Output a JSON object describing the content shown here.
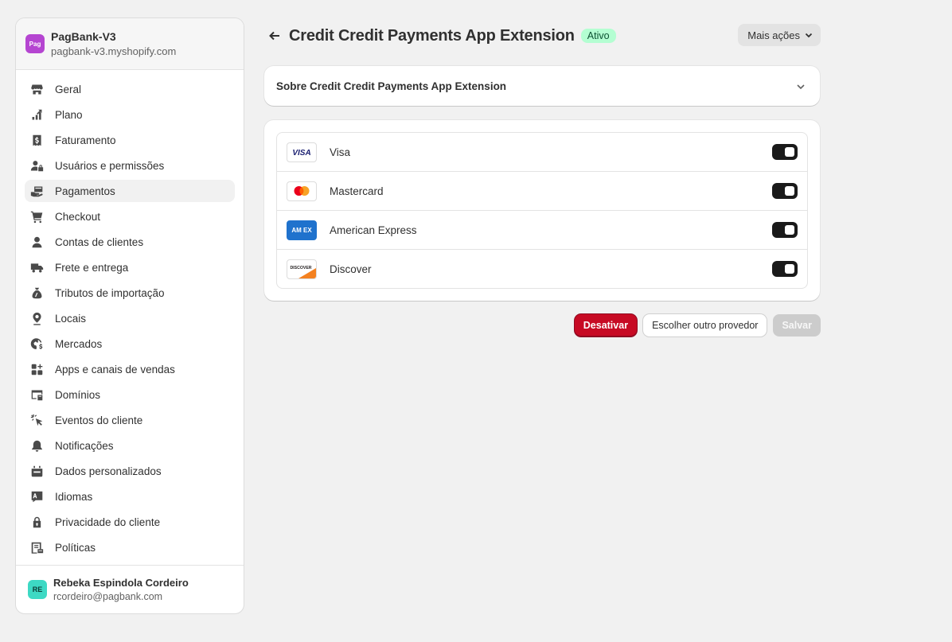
{
  "store": {
    "logo_text": "Pag",
    "name": "PagBank-V3",
    "domain": "pagbank-v3.myshopify.com"
  },
  "nav": {
    "items": [
      {
        "label": "Geral",
        "icon": "store-icon"
      },
      {
        "label": "Plano",
        "icon": "plan-chart-icon"
      },
      {
        "label": "Faturamento",
        "icon": "receipt-dollar-icon"
      },
      {
        "label": "Usuários e permissões",
        "icon": "users-lock-icon"
      },
      {
        "label": "Pagamentos",
        "icon": "payment-hand-icon",
        "active": true
      },
      {
        "label": "Checkout",
        "icon": "cart-icon"
      },
      {
        "label": "Contas de clientes",
        "icon": "person-icon"
      },
      {
        "label": "Frete e entrega",
        "icon": "truck-icon"
      },
      {
        "label": "Tributos de importação",
        "icon": "money-bag-icon"
      },
      {
        "label": "Locais",
        "icon": "location-pin-icon"
      },
      {
        "label": "Mercados",
        "icon": "globe-dollar-icon"
      },
      {
        "label": "Apps e canais de vendas",
        "icon": "apps-grid-icon"
      },
      {
        "label": "Domínios",
        "icon": "domain-window-icon"
      },
      {
        "label": "Eventos do cliente",
        "icon": "cursor-click-icon"
      },
      {
        "label": "Notificações",
        "icon": "bell-icon"
      },
      {
        "label": "Dados personalizados",
        "icon": "data-box-icon"
      },
      {
        "label": "Idiomas",
        "icon": "language-icon"
      },
      {
        "label": "Privacidade do cliente",
        "icon": "lock-icon"
      },
      {
        "label": "Políticas",
        "icon": "policy-document-icon"
      }
    ]
  },
  "user": {
    "initials": "RE",
    "name": "Rebeka Espindola Cordeiro",
    "email": "rcordeiro@pagbank.com"
  },
  "header": {
    "title": "Credit Credit Payments App Extension",
    "status": "Ativo",
    "more_actions_label": "Mais ações"
  },
  "about": {
    "title": "Sobre Credit Credit Payments App Extension"
  },
  "methods": [
    {
      "label": "Visa",
      "enabled": true,
      "logo": "visa-logo-icon",
      "logo_text": "VISA"
    },
    {
      "label": "Mastercard",
      "enabled": true,
      "logo": "mastercard-logo-icon",
      "logo_text": ""
    },
    {
      "label": "American Express",
      "enabled": true,
      "logo": "amex-logo-icon",
      "logo_text": "AM EX"
    },
    {
      "label": "Discover",
      "enabled": true,
      "logo": "discover-logo-icon",
      "logo_text": "DISCOVER"
    }
  ],
  "actions": {
    "deactivate_label": "Desativar",
    "choose_provider_label": "Escolher outro provedor",
    "save_label": "Salvar"
  },
  "colors": {
    "accent_danger": "#c70a24",
    "badge_success_bg": "#b4fed2",
    "toggle_on": "#1a1a1a"
  }
}
